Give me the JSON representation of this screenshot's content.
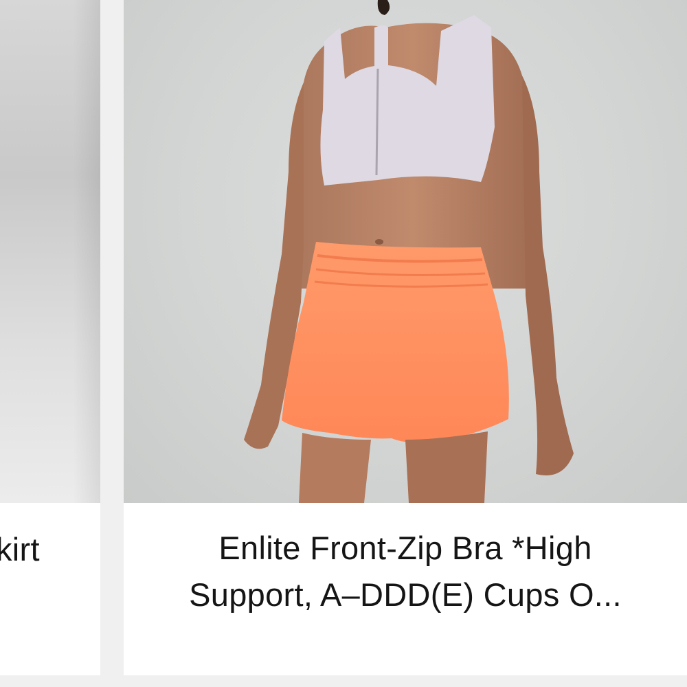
{
  "products": [
    {
      "title": "kirt"
    },
    {
      "title_lines": [
        "Enlite Front-Zip Bra *High",
        "Support, A–DDD(E) Cups O..."
      ]
    }
  ],
  "icons": {
    "left_image": "product-photo-skirt",
    "main_image": "product-photo-model"
  }
}
